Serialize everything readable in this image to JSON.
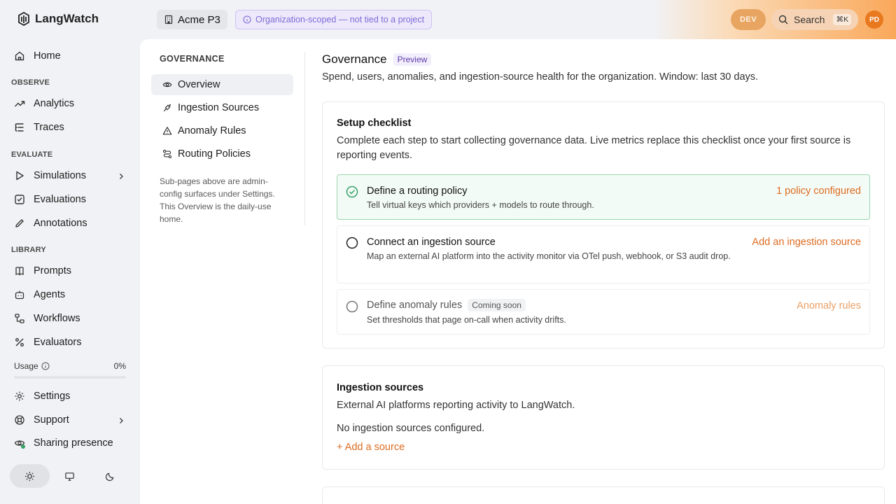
{
  "app": {
    "logo_text": "LangWatch"
  },
  "topbar": {
    "project": "Acme P3",
    "scope_note": "Organization-scoped — not tied to a project",
    "env_badge": "DEV",
    "search_label": "Search",
    "search_shortcut": "⌘K",
    "user_initials": "PD"
  },
  "sidebar": {
    "home": "Home",
    "observe_label": "OBSERVE",
    "analytics": "Analytics",
    "traces": "Traces",
    "evaluate_label": "EVALUATE",
    "simulations": "Simulations",
    "evaluations": "Evaluations",
    "annotations": "Annotations",
    "library_label": "LIBRARY",
    "prompts": "Prompts",
    "agents": "Agents",
    "workflows": "Workflows",
    "evaluators": "Evaluators",
    "usage_label": "Usage",
    "usage_value": "0%",
    "usage_fraction": 0,
    "settings": "Settings",
    "support": "Support",
    "sharing_presence": "Sharing presence",
    "theme_selected": "light"
  },
  "subnav": {
    "header": "GOVERNANCE",
    "items": [
      "Overview",
      "Ingestion Sources",
      "Anomaly Rules",
      "Routing Policies"
    ],
    "active": "Overview",
    "note": "Sub-pages above are admin-config surfaces under Settings. This Overview is the daily-use home."
  },
  "page": {
    "title": "Governance",
    "badge": "Preview",
    "subtitle": "Spend, users, anomalies, and ingestion-source health for the organization. Window: last 30 days."
  },
  "checklist": {
    "title": "Setup checklist",
    "description": "Complete each step to start collecting governance data. Live metrics replace this checklist once your first source is reporting events.",
    "steps": [
      {
        "title": "Define a routing policy",
        "desc": "Tell virtual keys which providers + models to route through.",
        "action": "1 policy configured",
        "status": "done"
      },
      {
        "title": "Connect an ingestion source",
        "desc": "Map an external AI platform into the activity monitor via OTel push, webhook, or S3 audit drop.",
        "action": "Add an ingestion source",
        "status": "todo"
      },
      {
        "title": "Define anomaly rules",
        "badge": "Coming soon",
        "desc": "Set thresholds that page on-call when activity drifts.",
        "action": "Anomaly rules",
        "status": "disabled"
      }
    ]
  },
  "ingestion": {
    "title": "Ingestion sources",
    "description": "External AI platforms reporting activity to LangWatch.",
    "empty": "No ingestion sources configured.",
    "add_link": "+ Add a source"
  },
  "colors": {
    "accent": "#dd6b20",
    "success": "#38a169",
    "purple": "#7d6bd6",
    "background": "#f1f2f5"
  }
}
